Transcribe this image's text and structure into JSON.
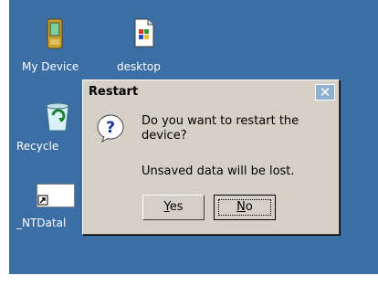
{
  "desktop": {
    "icons": [
      {
        "label": "My Device",
        "icon": "pda-device-icon"
      },
      {
        "label": "desktop",
        "icon": "document-file-icon"
      },
      {
        "label": "Recycle",
        "icon": "recycle-bin-icon"
      },
      {
        "label": "_NTDatal",
        "icon": "shortcut-file-icon"
      }
    ]
  },
  "dialog": {
    "title": "Restart",
    "close_label": "✕",
    "icon": "question-icon",
    "message": "Do you want to restart the device?",
    "detail": "Unsaved data will be lost.",
    "buttons": {
      "yes": {
        "mnemonic": "Y",
        "rest": "es"
      },
      "no": {
        "mnemonic": "N",
        "rest": "o"
      }
    }
  },
  "colors": {
    "desktop_bg": "#3a6ea5",
    "dialog_bg": "#d4d0c8",
    "close_bg": "#8fb0d0"
  }
}
